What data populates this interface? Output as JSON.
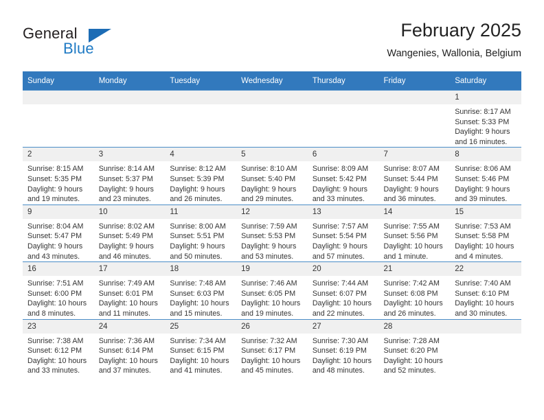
{
  "brand": {
    "name_top": "General",
    "name_bottom": "Blue",
    "accent_color": "#1f7ac4",
    "triangle_color": "#1c6cb5"
  },
  "header": {
    "title": "February 2025",
    "subtitle": "Wangenies, Wallonia, Belgium"
  },
  "calendar": {
    "header_bg": "#3279bd",
    "daynum_bg": "#f0f0f0",
    "weekdays": [
      "Sunday",
      "Monday",
      "Tuesday",
      "Wednesday",
      "Thursday",
      "Friday",
      "Saturday"
    ],
    "weeks": [
      [
        {
          "day": "",
          "lines": []
        },
        {
          "day": "",
          "lines": []
        },
        {
          "day": "",
          "lines": []
        },
        {
          "day": "",
          "lines": []
        },
        {
          "day": "",
          "lines": []
        },
        {
          "day": "",
          "lines": []
        },
        {
          "day": "1",
          "lines": [
            "Sunrise: 8:17 AM",
            "Sunset: 5:33 PM",
            "Daylight: 9 hours",
            "and 16 minutes."
          ]
        }
      ],
      [
        {
          "day": "2",
          "lines": [
            "Sunrise: 8:15 AM",
            "Sunset: 5:35 PM",
            "Daylight: 9 hours",
            "and 19 minutes."
          ]
        },
        {
          "day": "3",
          "lines": [
            "Sunrise: 8:14 AM",
            "Sunset: 5:37 PM",
            "Daylight: 9 hours",
            "and 23 minutes."
          ]
        },
        {
          "day": "4",
          "lines": [
            "Sunrise: 8:12 AM",
            "Sunset: 5:39 PM",
            "Daylight: 9 hours",
            "and 26 minutes."
          ]
        },
        {
          "day": "5",
          "lines": [
            "Sunrise: 8:10 AM",
            "Sunset: 5:40 PM",
            "Daylight: 9 hours",
            "and 29 minutes."
          ]
        },
        {
          "day": "6",
          "lines": [
            "Sunrise: 8:09 AM",
            "Sunset: 5:42 PM",
            "Daylight: 9 hours",
            "and 33 minutes."
          ]
        },
        {
          "day": "7",
          "lines": [
            "Sunrise: 8:07 AM",
            "Sunset: 5:44 PM",
            "Daylight: 9 hours",
            "and 36 minutes."
          ]
        },
        {
          "day": "8",
          "lines": [
            "Sunrise: 8:06 AM",
            "Sunset: 5:46 PM",
            "Daylight: 9 hours",
            "and 39 minutes."
          ]
        }
      ],
      [
        {
          "day": "9",
          "lines": [
            "Sunrise: 8:04 AM",
            "Sunset: 5:47 PM",
            "Daylight: 9 hours",
            "and 43 minutes."
          ]
        },
        {
          "day": "10",
          "lines": [
            "Sunrise: 8:02 AM",
            "Sunset: 5:49 PM",
            "Daylight: 9 hours",
            "and 46 minutes."
          ]
        },
        {
          "day": "11",
          "lines": [
            "Sunrise: 8:00 AM",
            "Sunset: 5:51 PM",
            "Daylight: 9 hours",
            "and 50 minutes."
          ]
        },
        {
          "day": "12",
          "lines": [
            "Sunrise: 7:59 AM",
            "Sunset: 5:53 PM",
            "Daylight: 9 hours",
            "and 53 minutes."
          ]
        },
        {
          "day": "13",
          "lines": [
            "Sunrise: 7:57 AM",
            "Sunset: 5:54 PM",
            "Daylight: 9 hours",
            "and 57 minutes."
          ]
        },
        {
          "day": "14",
          "lines": [
            "Sunrise: 7:55 AM",
            "Sunset: 5:56 PM",
            "Daylight: 10 hours",
            "and 1 minute."
          ]
        },
        {
          "day": "15",
          "lines": [
            "Sunrise: 7:53 AM",
            "Sunset: 5:58 PM",
            "Daylight: 10 hours",
            "and 4 minutes."
          ]
        }
      ],
      [
        {
          "day": "16",
          "lines": [
            "Sunrise: 7:51 AM",
            "Sunset: 6:00 PM",
            "Daylight: 10 hours",
            "and 8 minutes."
          ]
        },
        {
          "day": "17",
          "lines": [
            "Sunrise: 7:49 AM",
            "Sunset: 6:01 PM",
            "Daylight: 10 hours",
            "and 11 minutes."
          ]
        },
        {
          "day": "18",
          "lines": [
            "Sunrise: 7:48 AM",
            "Sunset: 6:03 PM",
            "Daylight: 10 hours",
            "and 15 minutes."
          ]
        },
        {
          "day": "19",
          "lines": [
            "Sunrise: 7:46 AM",
            "Sunset: 6:05 PM",
            "Daylight: 10 hours",
            "and 19 minutes."
          ]
        },
        {
          "day": "20",
          "lines": [
            "Sunrise: 7:44 AM",
            "Sunset: 6:07 PM",
            "Daylight: 10 hours",
            "and 22 minutes."
          ]
        },
        {
          "day": "21",
          "lines": [
            "Sunrise: 7:42 AM",
            "Sunset: 6:08 PM",
            "Daylight: 10 hours",
            "and 26 minutes."
          ]
        },
        {
          "day": "22",
          "lines": [
            "Sunrise: 7:40 AM",
            "Sunset: 6:10 PM",
            "Daylight: 10 hours",
            "and 30 minutes."
          ]
        }
      ],
      [
        {
          "day": "23",
          "lines": [
            "Sunrise: 7:38 AM",
            "Sunset: 6:12 PM",
            "Daylight: 10 hours",
            "and 33 minutes."
          ]
        },
        {
          "day": "24",
          "lines": [
            "Sunrise: 7:36 AM",
            "Sunset: 6:14 PM",
            "Daylight: 10 hours",
            "and 37 minutes."
          ]
        },
        {
          "day": "25",
          "lines": [
            "Sunrise: 7:34 AM",
            "Sunset: 6:15 PM",
            "Daylight: 10 hours",
            "and 41 minutes."
          ]
        },
        {
          "day": "26",
          "lines": [
            "Sunrise: 7:32 AM",
            "Sunset: 6:17 PM",
            "Daylight: 10 hours",
            "and 45 minutes."
          ]
        },
        {
          "day": "27",
          "lines": [
            "Sunrise: 7:30 AM",
            "Sunset: 6:19 PM",
            "Daylight: 10 hours",
            "and 48 minutes."
          ]
        },
        {
          "day": "28",
          "lines": [
            "Sunrise: 7:28 AM",
            "Sunset: 6:20 PM",
            "Daylight: 10 hours",
            "and 52 minutes."
          ]
        },
        {
          "day": "",
          "lines": []
        }
      ]
    ]
  }
}
